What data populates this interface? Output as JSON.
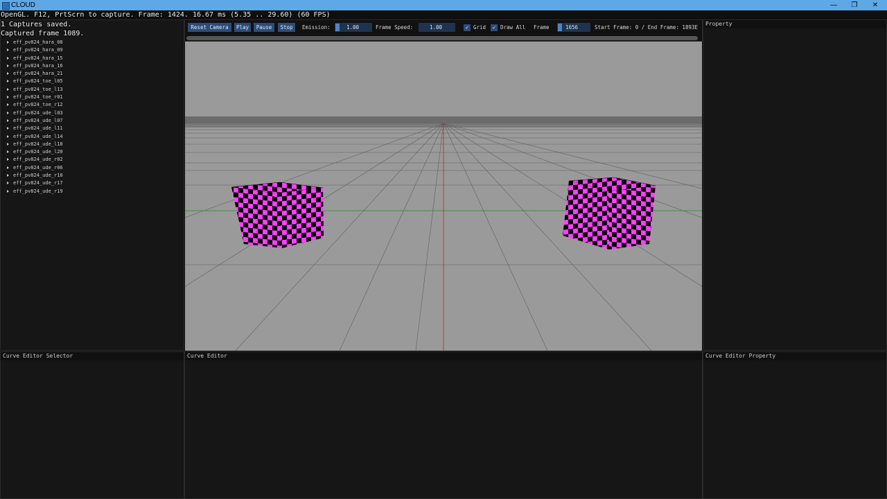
{
  "window": {
    "title": "CLOUD"
  },
  "overlay": {
    "line1": "OpenGL. F12, PrtScrn to capture. Frame: 1424. 16.67 ms (5.35 .. 29.60) (60 FPS)",
    "line2": "1 Captures saved.",
    "line3": "Captured frame 1089."
  },
  "tree": {
    "items": [
      "eff_pv824_hara_08",
      "eff_pv824_hara_09",
      "eff_pv824_hara_15",
      "eff_pv824_hara_16",
      "eff_pv824_hara_21",
      "eff_pv824_toe_l05",
      "eff_pv824_toe_l13",
      "eff_pv824_toe_r01",
      "eff_pv824_toe_r12",
      "eff_pv824_ude_l03",
      "eff_pv824_ude_l07",
      "eff_pv824_ude_l11",
      "eff_pv824_ude_l14",
      "eff_pv824_ude_l18",
      "eff_pv824_ude_l20",
      "eff_pv824_ude_r02",
      "eff_pv824_ude_r06",
      "eff_pv824_ude_r10",
      "eff_pv824_ude_r17",
      "eff_pv824_ude_r19"
    ]
  },
  "toolbar": {
    "reset_camera": "Reset Camera",
    "play": "Play",
    "pause": "Pause",
    "stop": "Stop",
    "emission_label": "Emission:",
    "emission_value": "1.00",
    "frame_speed_label": "Frame Speed:",
    "frame_speed_value": "1.00",
    "grid_label": "Grid",
    "grid_checked": true,
    "draw_all_label": "Draw All",
    "draw_all_checked": true,
    "frame_label": "Frame",
    "frame_value": "1656",
    "start_end_label": "Start Frame: 0 / End Frame: 1893E"
  },
  "panels": {
    "property": "Property",
    "curve_editor_selector": "Curve Editor Selector",
    "curve_editor": "Curve Editor",
    "curve_editor_property": "Curve Editor Property"
  },
  "colors": {
    "viewport_bg": "#9a9a9a",
    "checker_a": "#ff40ff",
    "checker_b": "#000000",
    "axis_red": "#d02020",
    "axis_green": "#2a9a2a",
    "button_blue": "#2b4c7a"
  }
}
